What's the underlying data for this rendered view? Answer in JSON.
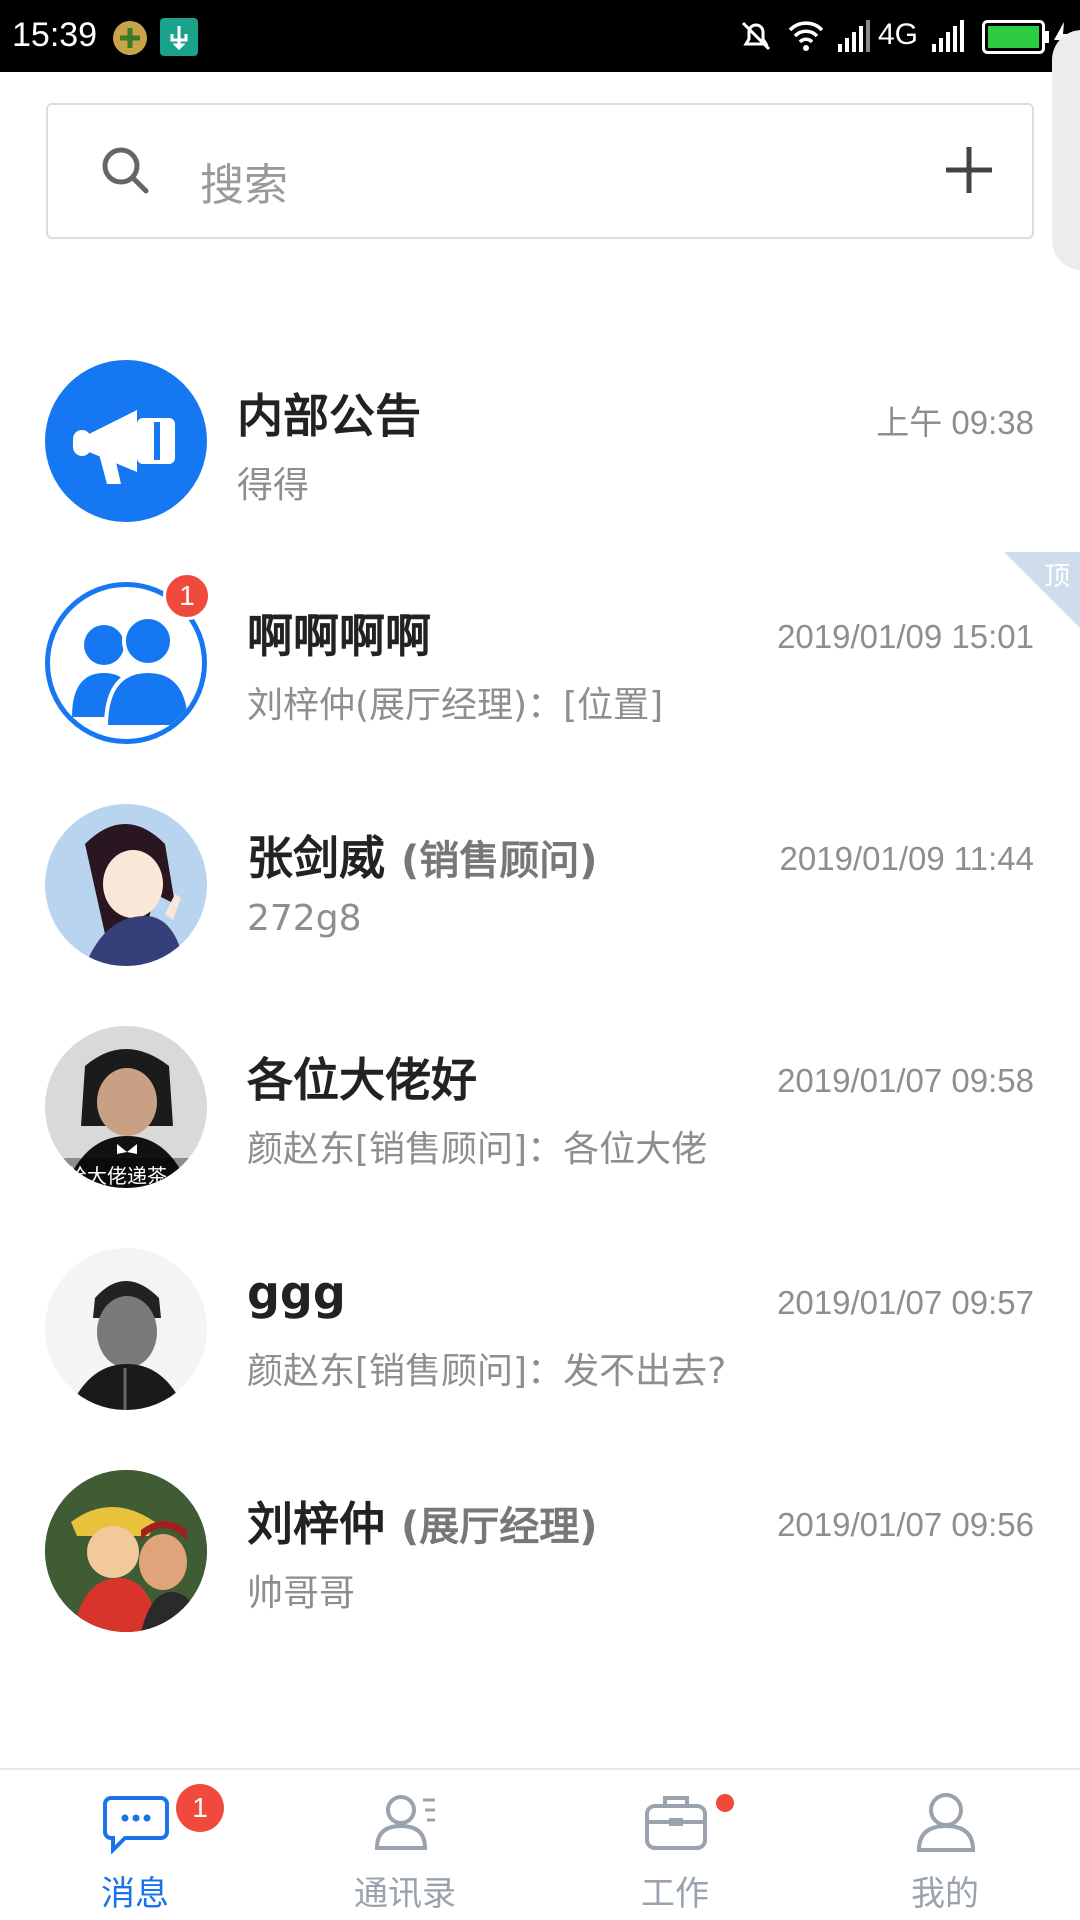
{
  "status_bar": {
    "time": "15:39",
    "network": "4G"
  },
  "search": {
    "placeholder": "搜索"
  },
  "conversations": [
    {
      "title": "内部公告",
      "role": "",
      "time": "上午 09:38",
      "preview": "得得",
      "avatar": "megaphone-avatar"
    },
    {
      "title": "啊啊啊啊",
      "role": "",
      "time": "2019/01/09 15:01",
      "preview": "刘梓仲(展厅经理)：[位置]",
      "avatar": "group-avatar",
      "badge": "1",
      "pinned_label": "顶"
    },
    {
      "title": "张剑威",
      "role": "(销售顾问)",
      "time": "2019/01/09 11:44",
      "preview": "272g8",
      "avatar": "anime-girl-avatar"
    },
    {
      "title": "各位大佬好",
      "role": "",
      "time": "2019/01/07 09:58",
      "preview": "颜赵东[销售顾问]：各位大佬",
      "avatar": "tuxedo-man-avatar",
      "avatar_caption": "给大佬递茶"
    },
    {
      "title": "ggg",
      "role": "",
      "time": "2019/01/07 09:57",
      "preview": "颜赵东[销售顾问]：发不出去?",
      "avatar": "portrait-avatar"
    },
    {
      "title": "刘梓仲",
      "role": "(展厅经理)",
      "time": "2019/01/07 09:56",
      "preview": "帅哥哥",
      "avatar": "cartoon-avatar"
    }
  ],
  "nav": [
    {
      "label": "消息",
      "icon": "chat-icon",
      "badge": "1",
      "active": true
    },
    {
      "label": "通讯录",
      "icon": "contacts-icon"
    },
    {
      "label": "工作",
      "icon": "briefcase-icon",
      "dot": true
    },
    {
      "label": "我的",
      "icon": "profile-icon"
    }
  ],
  "colors": {
    "accent": "#1a73e8",
    "badge": "#f04a3c",
    "muted": "#8e8e8e"
  }
}
